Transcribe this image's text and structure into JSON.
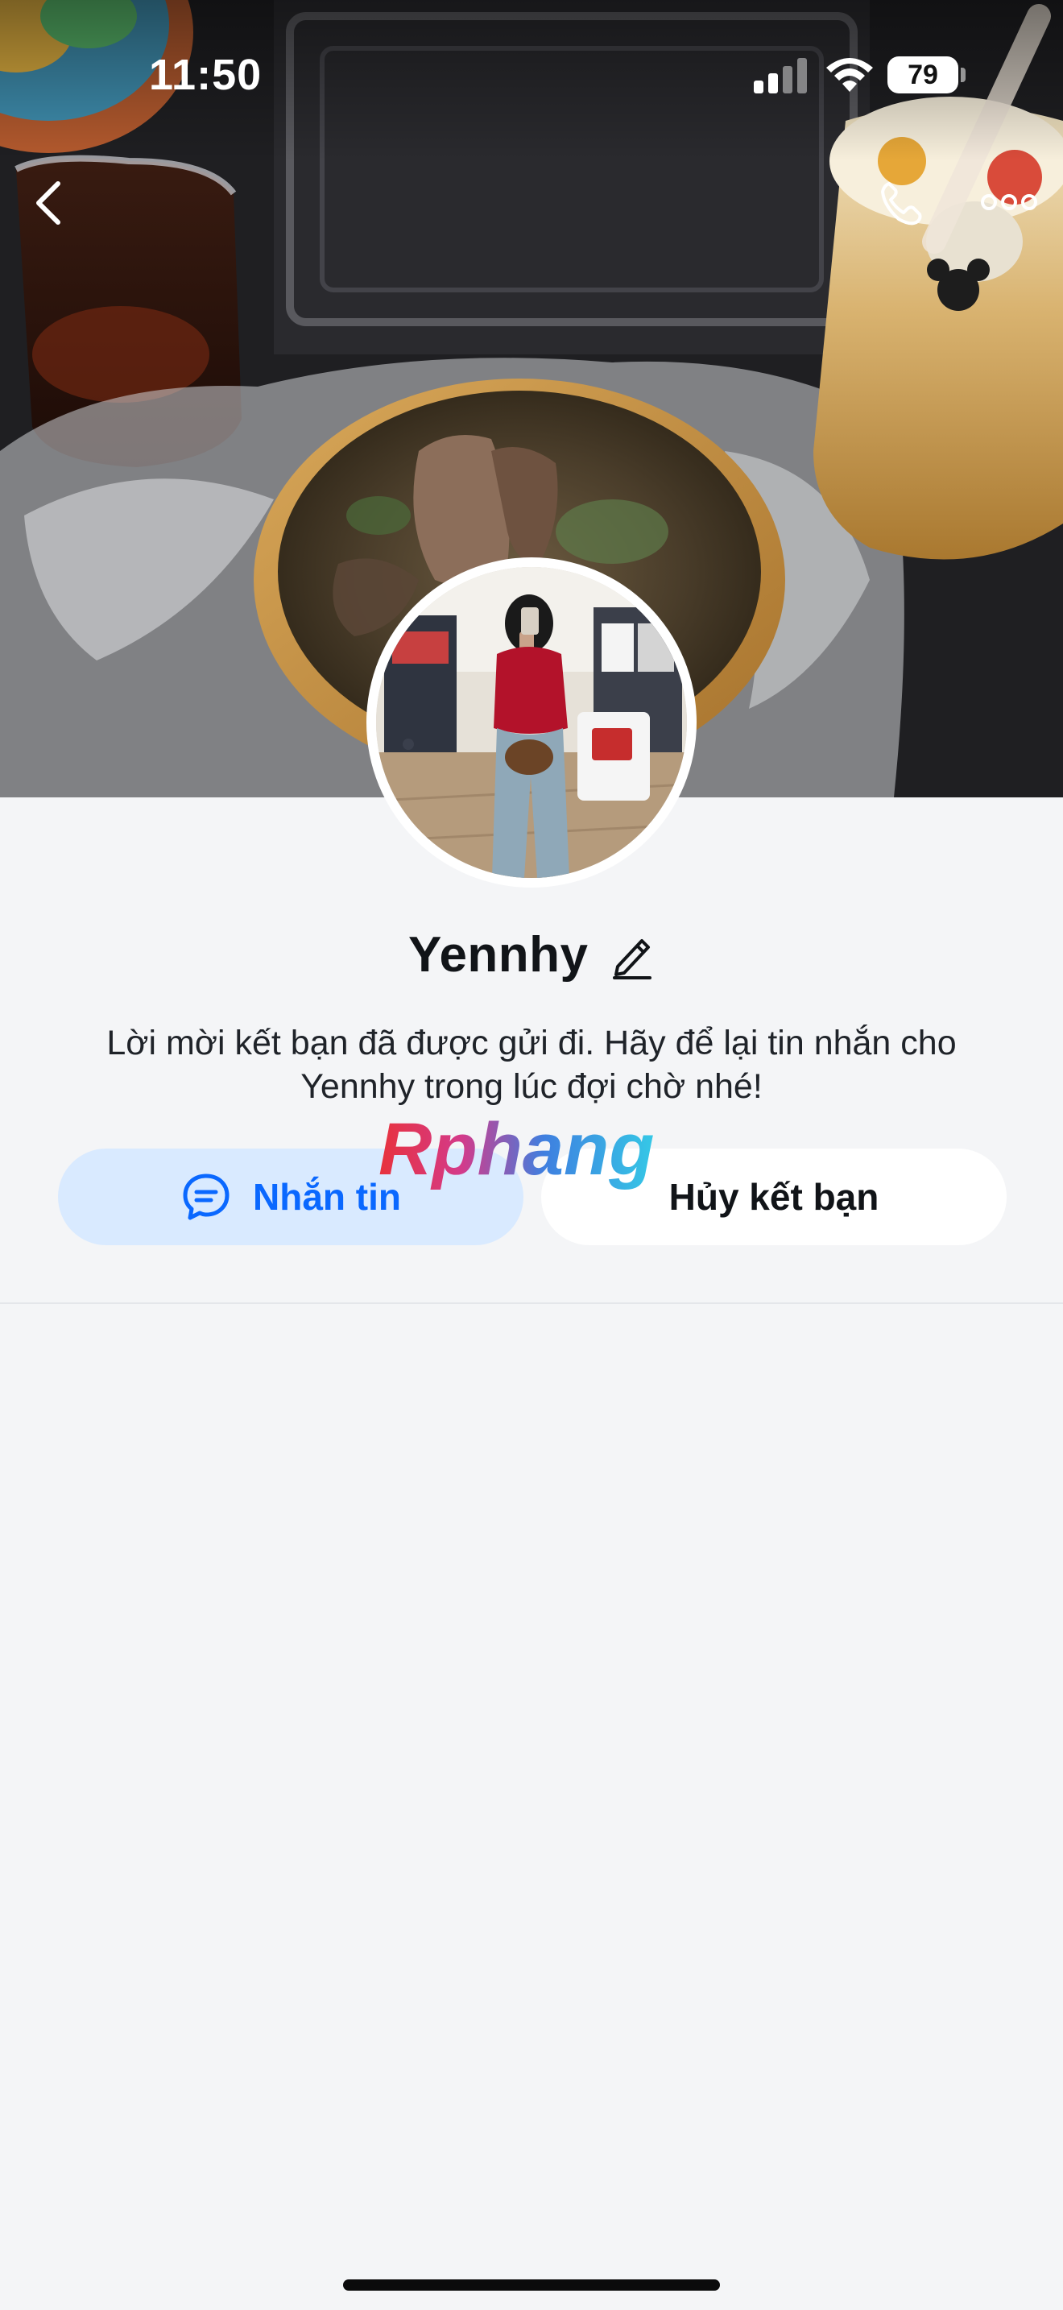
{
  "status_bar": {
    "time": "11:50",
    "battery": "79"
  },
  "header": {
    "back_icon": "chevron-left-icon",
    "call_icon": "phone-icon",
    "more_icon": "ellipsis-icon"
  },
  "profile": {
    "name": "Yennhy",
    "edit_icon": "pencil-icon",
    "request_message": "Lời mời kết bạn đã được gửi đi. Hãy để lại tin nhắn cho Yennhy trong lúc đợi chờ nhé!"
  },
  "actions": {
    "message_label": "Nhắn tin",
    "message_icon": "chat-bubble-icon",
    "unfriend_label": "Hủy kết bạn"
  },
  "watermark": {
    "text": "Rphang"
  },
  "colors": {
    "accent": "#0a68ff",
    "message_button_bg": "#d9eaff",
    "page_bg": "#f4f5f7"
  }
}
